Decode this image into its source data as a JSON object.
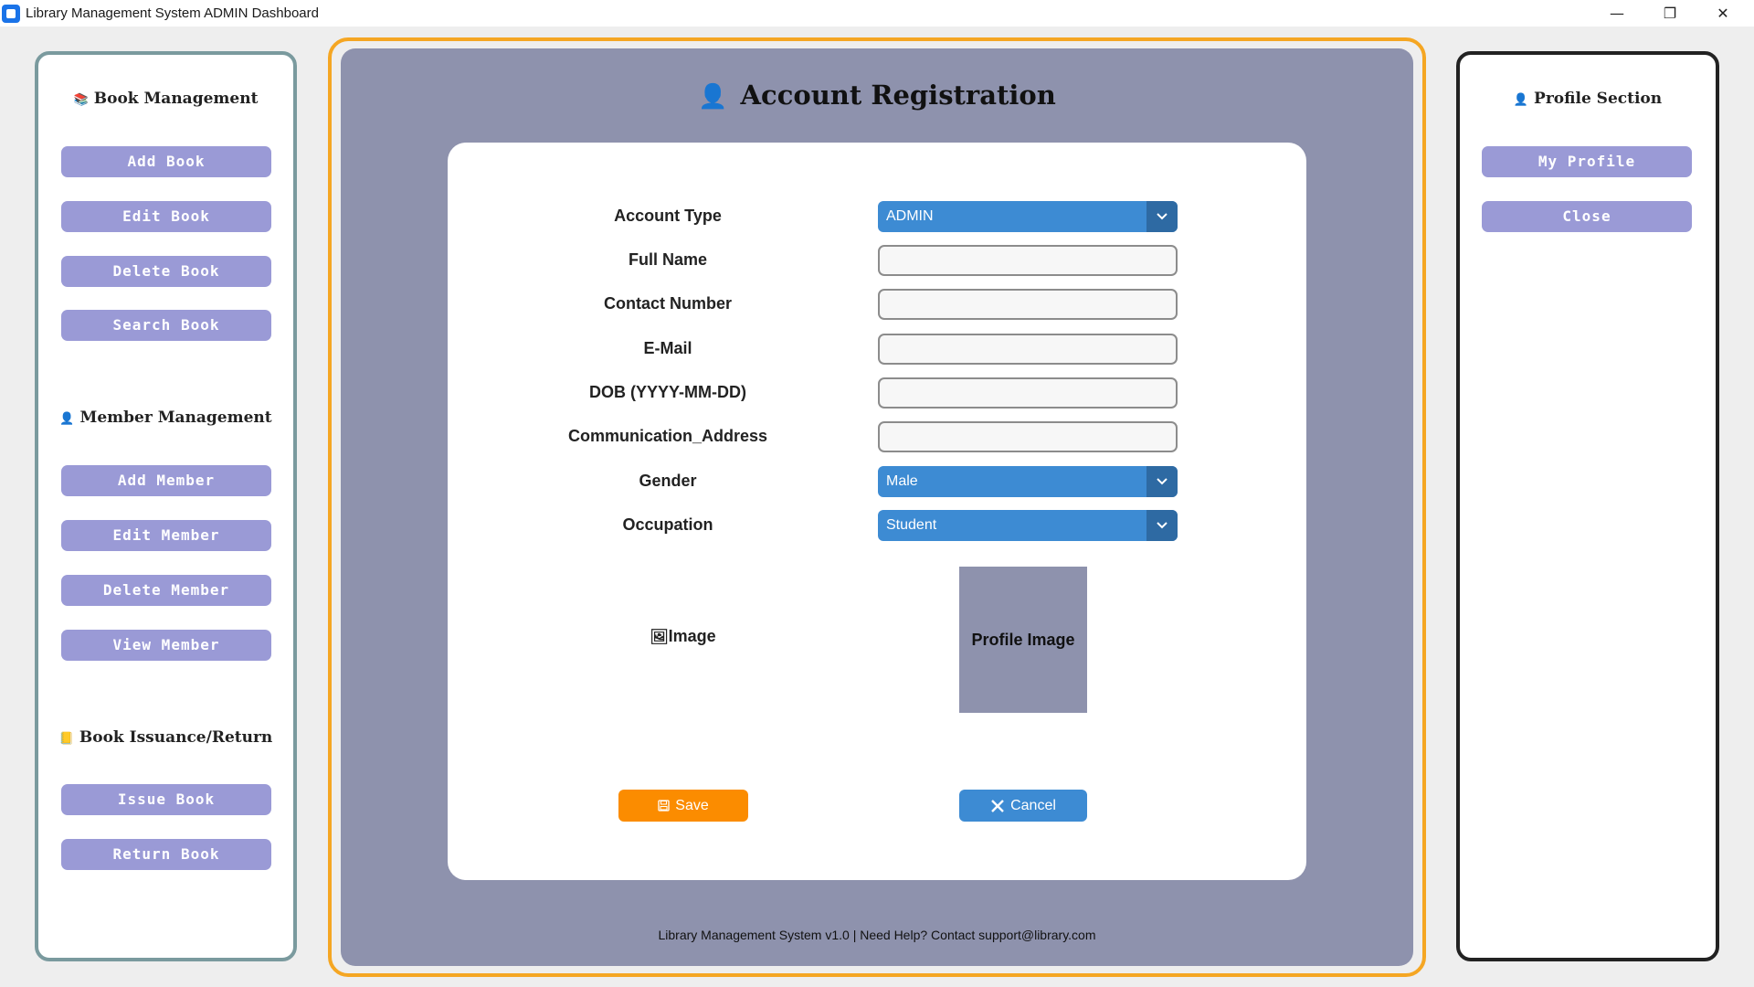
{
  "window": {
    "title": "Library Management System ADMIN Dashboard",
    "controls": {
      "minimize": "—",
      "restore": "❐",
      "close": "✕"
    }
  },
  "left_panel": {
    "book_management": {
      "heading": "Book Management",
      "icon": "books-icon",
      "buttons": [
        "Add Book",
        "Edit Book",
        "Delete Book",
        "Search Book"
      ]
    },
    "member_management": {
      "heading": "Member Management",
      "icon": "person-icon",
      "buttons": [
        "Add Member",
        "Edit Member",
        "Delete Member",
        "View Member"
      ]
    },
    "book_issuance": {
      "heading": "Book Issuance/Return",
      "icon": "ledger-icon",
      "buttons": [
        "Issue Book",
        "Return Book"
      ]
    }
  },
  "main": {
    "title": "Account Registration",
    "title_icon": "person-icon",
    "form": {
      "account_type": {
        "label": "Account Type",
        "value": "ADMIN"
      },
      "full_name": {
        "label": "Full Name",
        "value": ""
      },
      "contact_number": {
        "label": "Contact Number",
        "value": ""
      },
      "email": {
        "label": "E-Mail",
        "value": ""
      },
      "dob": {
        "label": "DOB (YYYY-MM-DD)",
        "value": ""
      },
      "address": {
        "label": "Communication_Address",
        "value": ""
      },
      "gender": {
        "label": "Gender",
        "value": "Male"
      },
      "occupation": {
        "label": "Occupation",
        "value": "Student"
      },
      "image": {
        "label": "Image",
        "placeholder": "Profile Image"
      }
    },
    "save_label": "Save",
    "cancel_label": "Cancel",
    "footer": "Library Management System v1.0 | Need Help? Contact support@library.com"
  },
  "right_panel": {
    "heading": "Profile Section",
    "icon": "person-icon",
    "buttons": [
      "My Profile",
      "Close"
    ]
  },
  "colors": {
    "accent_orange": "#f5a623",
    "save_orange": "#fb8c00",
    "select_blue": "#3d8bd3",
    "side_button_purple": "#9a9ad6",
    "main_background": "#8e92ad"
  }
}
